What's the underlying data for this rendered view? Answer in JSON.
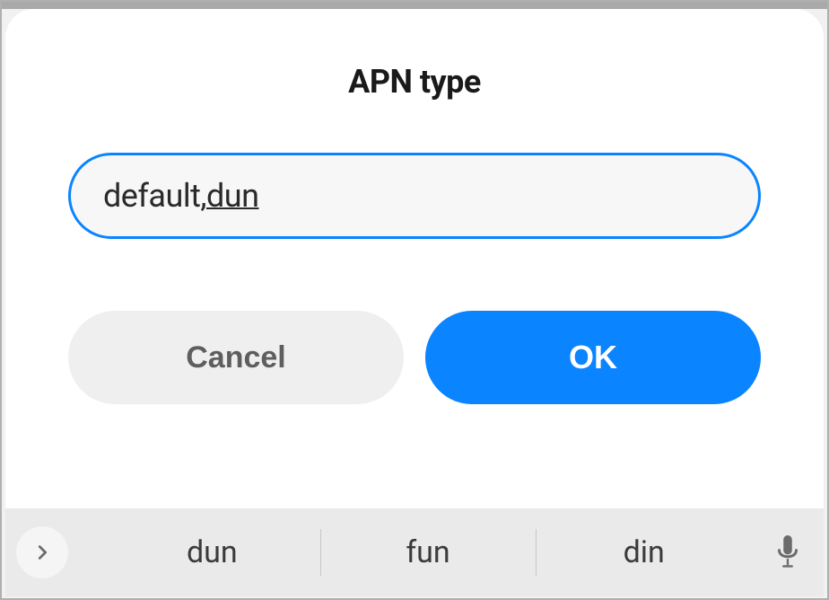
{
  "dialog": {
    "title": "APN type",
    "input_prefix": "default,",
    "input_suffix": "dun",
    "cancel_label": "Cancel",
    "ok_label": "OK"
  },
  "keyboard": {
    "expand_icon": "chevron-right",
    "suggestions": [
      "dun",
      "fun",
      "din"
    ],
    "mic_icon": "mic"
  },
  "colors": {
    "accent": "#0a84ff",
    "cancel_bg": "#efefef",
    "cancel_text": "#5e5e5e"
  }
}
